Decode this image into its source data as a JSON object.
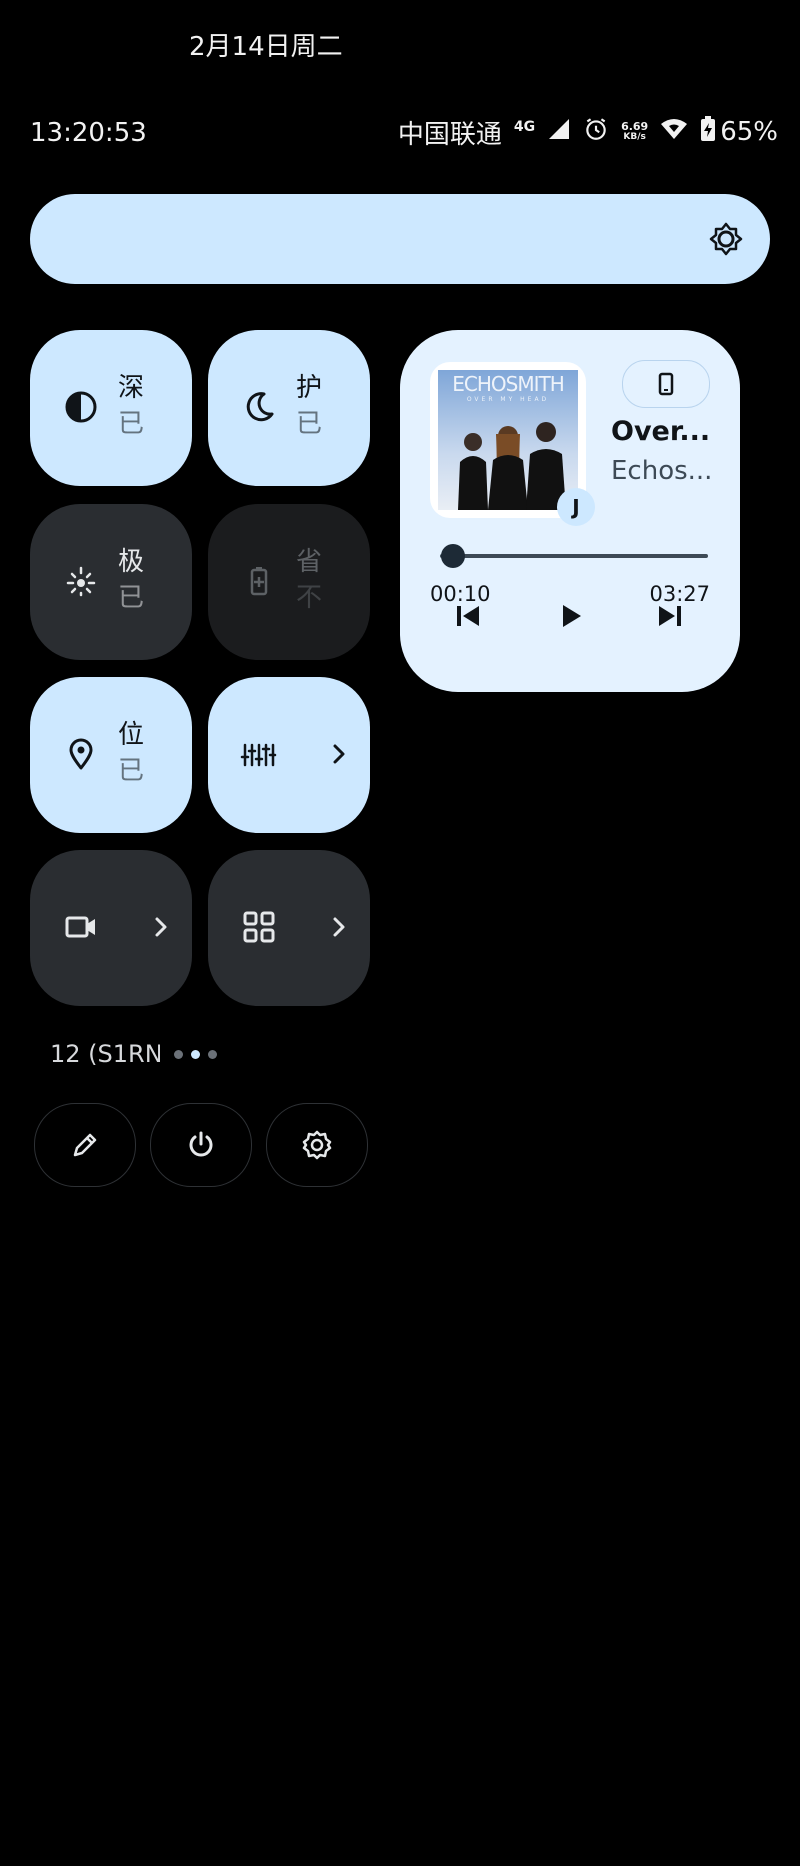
{
  "header": {
    "date": "2月14日周二",
    "time": "13:20:53"
  },
  "status_bar": {
    "carrier": "中国联通",
    "network": "4G",
    "speed_value": "6.69",
    "speed_unit": "KB/s",
    "battery": "65%",
    "icons": [
      "signal-icon",
      "alarm-icon",
      "wifi-icon",
      "battery-charging-icon"
    ]
  },
  "brightness": {
    "icon": "brightness-icon",
    "level": 0
  },
  "tiles": [
    {
      "icon": "dark-mode-icon",
      "label": "深",
      "sub": "已",
      "state": "on"
    },
    {
      "icon": "moon-icon",
      "label": "护",
      "sub": "已",
      "state": "on"
    },
    {
      "icon": "extreme-dim-icon",
      "label": "极",
      "sub": "已",
      "state": "off"
    },
    {
      "icon": "battery-saver-icon",
      "label": "省",
      "sub": "不",
      "state": "unavailable"
    },
    {
      "icon": "location-icon",
      "label": "位",
      "sub": "已",
      "state": "on"
    },
    {
      "icon": "equalizer-icon",
      "label": "",
      "sub": "",
      "state": "on"
    },
    {
      "icon": "screen-record-icon",
      "label": "",
      "sub": "",
      "state": "off"
    },
    {
      "icon": "apps-grid-icon",
      "label": "",
      "sub": "",
      "state": "off"
    }
  ],
  "media": {
    "album_text": "ECHOSMITH",
    "album_subtext": "OVER MY HEAD",
    "app_badge": "J",
    "song": "Over...",
    "artist": "Echos...",
    "elapsed": "00:10",
    "duration": "03:27",
    "progress": 0.05
  },
  "footer": {
    "ssid": "12 (S1RN",
    "page_count": 3,
    "active_page": 1
  },
  "actions": [
    "edit-icon",
    "power-icon",
    "settings-icon"
  ]
}
